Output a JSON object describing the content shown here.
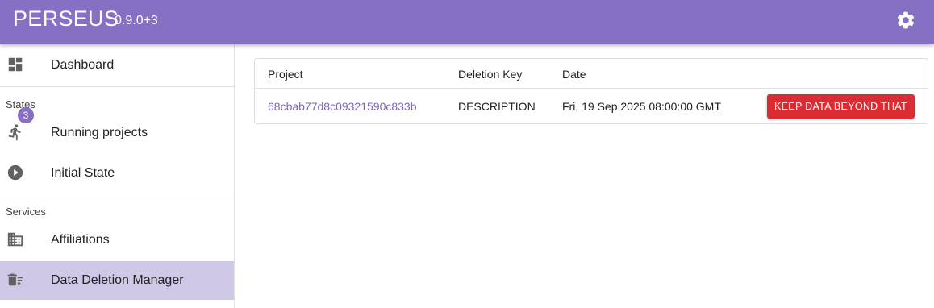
{
  "app": {
    "title": "PERSEUS",
    "version": "0.9.0+3",
    "accent_color": "#8570c4"
  },
  "header": {
    "settings_icon": "gear-icon"
  },
  "sidebar": {
    "items": [
      {
        "label": "Dashboard",
        "icon": "dashboard-icon"
      },
      {
        "label": "Running projects",
        "icon": "running-person-icon",
        "badge": "3"
      },
      {
        "label": "Initial State",
        "icon": "play-circle-icon"
      },
      {
        "label": "Affiliations",
        "icon": "building-icon"
      },
      {
        "label": "Data Deletion Manager",
        "icon": "delete-list-icon",
        "active": true
      }
    ],
    "sections": {
      "states": "States",
      "services": "Services"
    }
  },
  "table": {
    "headers": {
      "project": "Project",
      "deletion_key": "Deletion Key",
      "date": "Date"
    },
    "rows": [
      {
        "project": "68cbab77d8c09321590c833b",
        "deletion_key": "DESCRIPTION",
        "date": "Fri, 19 Sep 2025 08:00:00 GMT",
        "action_label": "KEEP DATA BEYOND THAT"
      }
    ],
    "action_color": "#d92d33"
  }
}
